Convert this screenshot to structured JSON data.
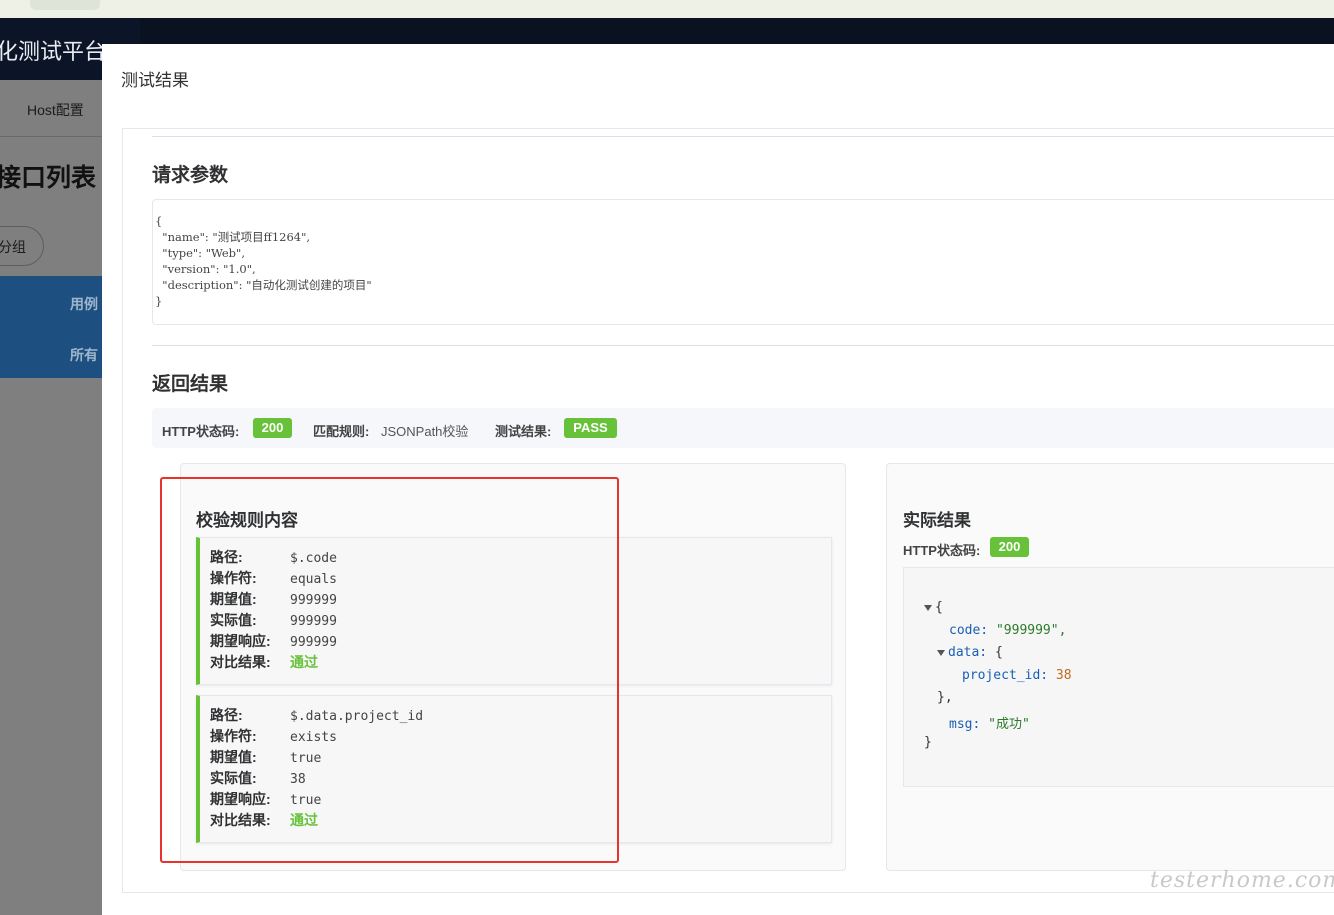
{
  "background": {
    "platform_title": "化测试平台",
    "host_tab": "Host配置",
    "page_heading": "接口列表",
    "group_button": "分组",
    "sidebar_items": [
      "用例",
      "所有"
    ]
  },
  "modal": {
    "title": "测试结果",
    "request": {
      "heading": "请求参数",
      "body": "{\n  \"name\": \"测试项目ff1264\",\n  \"type\": \"Web\",\n  \"version\": \"1.0\",\n  \"description\": \"自动化测试创建的项目\"\n}"
    },
    "response": {
      "heading": "返回结果",
      "status_code_label": "HTTP状态码:",
      "status_code": "200",
      "match_rule_label": "匹配规则:",
      "match_rule": "JSONPath校验",
      "test_result_label": "测试结果:",
      "test_result": "PASS"
    },
    "rules_panel": {
      "title": "校验规则内容",
      "labels": {
        "path": "路径:",
        "operator": "操作符:",
        "expected": "期望值:",
        "actual": "实际值:",
        "expected_response": "期望响应:",
        "compare": "对比结果:"
      },
      "rules": [
        {
          "path": "$.code",
          "operator": "equals",
          "expected": "999999",
          "actual": "999999",
          "expected_response": "999999",
          "compare": "通过"
        },
        {
          "path": "$.data.project_id",
          "operator": "exists",
          "expected": "true",
          "actual": "38",
          "expected_response": "true",
          "compare": "通过"
        }
      ]
    },
    "actual_panel": {
      "title": "实际结果",
      "status_code_label": "HTTP状态码:",
      "status_code": "200",
      "json": {
        "open_brace": "{",
        "code_key": "code:",
        "code_value": "\"999999\",",
        "data_key": "data:",
        "data_open": "{",
        "project_id_key": "project_id:",
        "project_id_value": "38",
        "data_close": "},",
        "msg_key": "msg:",
        "msg_value": "\"成功\"",
        "close_brace": "}"
      }
    }
  },
  "watermark": "testerhome.com",
  "colors": {
    "success": "#67c23a",
    "highlight": "#e8322c",
    "json_key": "#1a5fb4",
    "json_string": "#2b7a2b",
    "json_number": "#c06a1e"
  }
}
